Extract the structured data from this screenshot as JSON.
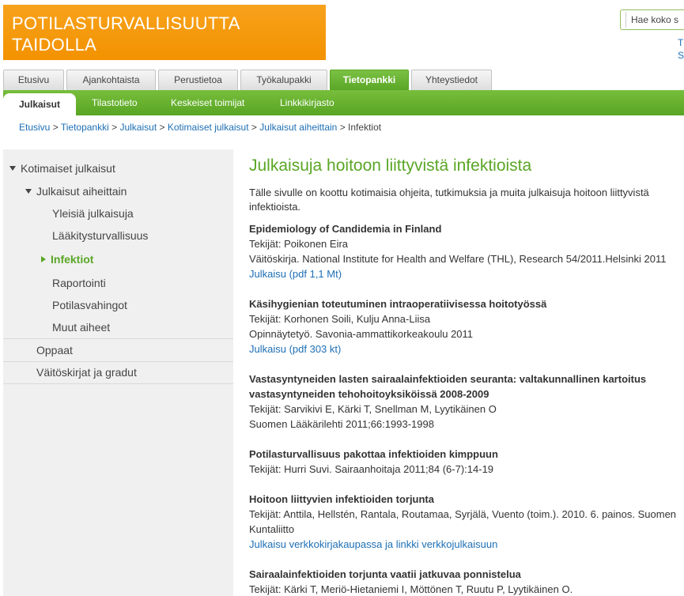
{
  "header": {
    "logo_line1": "POTILASTURVALLISUUTTA",
    "logo_line2": "TAIDOLLA",
    "search_placeholder": "Hae koko s",
    "corner_link1": "T",
    "corner_link2": "S"
  },
  "top_tabs": [
    {
      "label": "Etusivu",
      "active": false
    },
    {
      "label": "Ajankohtaista",
      "active": false
    },
    {
      "label": "Perustietoa",
      "active": false
    },
    {
      "label": "Työkalupakki",
      "active": false
    },
    {
      "label": "Tietopankki",
      "active": true
    },
    {
      "label": "Yhteystiedot",
      "active": false
    }
  ],
  "sub_tabs": [
    {
      "label": "Julkaisut",
      "active": true
    },
    {
      "label": "Tilastotieto",
      "active": false
    },
    {
      "label": "Keskeiset toimijat",
      "active": false
    },
    {
      "label": "Linkkikirjasto",
      "active": false
    }
  ],
  "breadcrumb": {
    "items": [
      "Etusivu",
      "Tietopankki",
      "Julkaisut",
      "Kotimaiset julkaisut",
      "Julkaisut aiheittain"
    ],
    "current": "Infektiot",
    "separator": ">"
  },
  "sidebar": {
    "items": [
      {
        "label": "Kotimaiset julkaisut"
      },
      {
        "label": "Julkaisut aiheittain"
      },
      {
        "label": "Yleisiä julkaisuja"
      },
      {
        "label": "Lääkitysturvallisuus"
      },
      {
        "label": "Infektiot"
      },
      {
        "label": "Raportointi"
      },
      {
        "label": "Potilasvahingot"
      },
      {
        "label": "Muut aiheet"
      },
      {
        "label": "Oppaat"
      },
      {
        "label": "Väitöskirjat ja gradut"
      }
    ]
  },
  "main": {
    "title": "Julkaisuja hoitoon liittyvistä infektioista",
    "intro": "Tälle sivulle on koottu kotimaisia ohjeita, tutkimuksia ja muita julkaisuja hoitoon liittyvistä infektioista.",
    "publications": [
      {
        "title": "Epidemiology of Candidemia in Finland",
        "lines": [
          "Tekijät: Poikonen Eira",
          "Väitöskirja. National Institute for Health and Welfare (THL), Research 54/2011.Helsinki 2011"
        ],
        "link": "Julkaisu (pdf 1,1 Mt)"
      },
      {
        "title": "Käsihygienian toteutuminen intraoperatiivisessa hoitotyössä",
        "lines": [
          "Tekijät: Korhonen Soili, Kulju Anna-Liisa",
          "Opinnäytetyö. Savonia-ammattikorkeakoulu 2011"
        ],
        "link": "Julkaisu (pdf 303 kt)"
      },
      {
        "title": "Vastasyntyneiden lasten sairaalainfektioiden seuranta: valtakunnallinen kartoitus vastasyntyneiden tehohoitoyksiköissä 2008-2009",
        "lines": [
          "Tekijät: Sarvikivi E, Kärki T, Snellman M, Lyytikäinen O",
          "Suomen Lääkärilehti 2011;66:1993-1998"
        ],
        "link": ""
      },
      {
        "title": "Potilasturvallisuus pakottaa infektioiden kimppuun",
        "lines": [
          "Tekijät: Hurri Suvi. Sairaanhoitaja 2011;84 (6-7):14-19"
        ],
        "link": ""
      },
      {
        "title": "Hoitoon liittyvien infektioiden torjunta",
        "lines": [
          "Tekijät: Anttila, Hellstén, Rantala, Routamaa, Syrjälä, Vuento (toim.). 2010. 6. painos. Suomen Kuntaliitto"
        ],
        "link": "Julkaisu verkkokirjakaupassa ja linkki verkkojulkaisuun"
      },
      {
        "title": "Sairaalainfektioiden torjunta vaatii jatkuvaa ponnistelua",
        "lines": [
          "Tekijät: Kärki T, Meriö-Hietaniemi I, Möttönen T, Ruutu P, Lyytikäinen O."
        ],
        "link": ""
      }
    ]
  },
  "colors": {
    "brand_orange": "#f39200",
    "brand_green": "#5aa626",
    "link_blue": "#1e6fb5"
  }
}
